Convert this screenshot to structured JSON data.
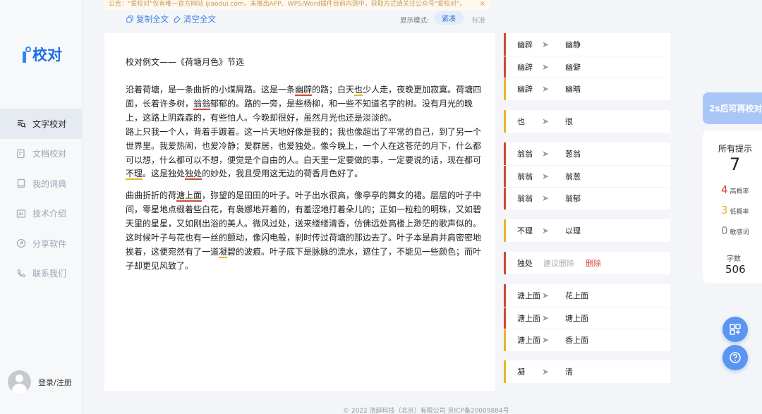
{
  "notice": {
    "text": "公告：\"爱校对\"仅有唯一官方网站 ijiaodui.com，未推出APP、WPS/Word插件目前内测中，获取方式请关注公众号\"爱校对\"。",
    "close": "×"
  },
  "logo": {
    "text": "校对"
  },
  "nav": [
    {
      "label": "文字校对",
      "icon": "text-check-icon"
    },
    {
      "label": "文档校对",
      "icon": "document-check-icon"
    },
    {
      "label": "我的词典",
      "icon": "dictionary-icon"
    },
    {
      "label": "技术介绍",
      "icon": "tech-icon"
    },
    {
      "label": "分享软件",
      "icon": "share-icon"
    },
    {
      "label": "联系我们",
      "icon": "phone-icon"
    }
  ],
  "login": {
    "label": "登录/注册"
  },
  "toolbar": {
    "copy_label": "复制全文",
    "clear_label": "清空全文",
    "mode_label": "显示模式:",
    "mode_compact": "紧凑",
    "mode_standard": "标准"
  },
  "doc": {
    "title": "校对例文——《荷塘月色》节选",
    "p1": {
      "a": "沿着荷塘，是一条曲折的小煤屑路。这是一条",
      "b": "幽辟",
      "c": "的路；白天",
      "d": "也",
      "e": "少人走，夜晚更加寂寞。荷塘四面，长着许多树，",
      "f": "翁翁",
      "g": "郁郁的。路的一旁，是些杨柳，和一些不知道名字的树。没有月光的晚上，这路上阴森森的，有些怕人。今晚却很好，虽然月光也还是淡淡的。"
    },
    "p2": {
      "a": "路上只我一个人，背着手踱着。这一片天地好像是我的；我也像超出了平常的自己，到了另一个世界里。我爱热闹，也爱冷静；爱群居，也爱独处。像今晚上，一个人在这苍茫的月下，什么都可以想，什么都可以不想，便觉是个自由的人。白天里一定要做的事，一定要说的话，现在都可",
      "b": "不理",
      "c": "。这是",
      "d": "独处",
      "e": "独处",
      "f": "的妙处，我且受用这无边的荷香月色好了。"
    },
    "p3": {
      "a": "曲曲折折的荷",
      "b": "溏上面",
      "c": "，弥望的是田田的叶子。叶子出水很高，像亭亭的舞女的裙。层层的叶子中间，零星地点缀着些白花，有袅娜地开着的，有羞涩地打着朵儿的；正如一粒粒的明珠，又如碧天里的星星，又如刚出浴的美人。微风过处，送来缕缕清香，仿佛远处高楼上渺茫的歌声似的。这时候叶子与花也有一丝的颤动，像闪电般，刹时传过荷塘的那边去了。叶子本是肩并肩密密地挨着，这便宛然有了一道",
      "d": "凝",
      "e": "碧的波痕。叶子底下是脉脉的流水，遮住了，不能见一些颜色；而叶子却更见风致了。"
    }
  },
  "suggestions": [
    {
      "type": "replace",
      "severity": "red",
      "from": "幽辟",
      "to": "幽静"
    },
    {
      "type": "replace",
      "severity": "red",
      "from": "幽辟",
      "to": "幽僻"
    },
    {
      "type": "replace",
      "severity": "yellow",
      "from": "幽辟",
      "to": "幽暗"
    },
    {
      "type": "replace",
      "severity": "yellow",
      "from": "也",
      "to": "很"
    },
    {
      "type": "replace",
      "severity": "red",
      "from": "翁翁",
      "to": "葱翁"
    },
    {
      "type": "replace",
      "severity": "red",
      "from": "翁翁",
      "to": "翁葱"
    },
    {
      "type": "replace",
      "severity": "red",
      "from": "翁翁",
      "to": "翁郁"
    },
    {
      "type": "replace",
      "severity": "yellow",
      "from": "不理",
      "to": "以理"
    },
    {
      "type": "delete",
      "severity": "red",
      "from": "独处",
      "ignore": "建议删除",
      "action": "删除"
    },
    {
      "type": "replace",
      "severity": "red",
      "from": "溏上面",
      "to": "花上面"
    },
    {
      "type": "replace",
      "severity": "red",
      "from": "溏上面",
      "to": "塘上面"
    },
    {
      "type": "replace",
      "severity": "yellow",
      "from": "溏上面",
      "to": "香上面"
    },
    {
      "type": "replace",
      "severity": "yellow",
      "from": "凝",
      "to": "清"
    }
  ],
  "arrow_glyph": "➤",
  "panel": {
    "recheck": "2s后可再校对",
    "all_label": "所有提示",
    "all_count": "7",
    "high_count": "4",
    "high_label": "高概率",
    "low_count": "3",
    "low_label": "低概率",
    "sensitive_count": "0",
    "sensitive_label": "敏感词",
    "wc_label": "字数",
    "wc_value": "506"
  },
  "colors": {
    "accent": "#2f86f5",
    "high": "#cd4a3a",
    "low": "#eab42a"
  },
  "fabs": [
    "apps-icon",
    "help-icon"
  ],
  "footer": "© 2022 清辞科技（北京）有限公司 京ICP备20009884号"
}
